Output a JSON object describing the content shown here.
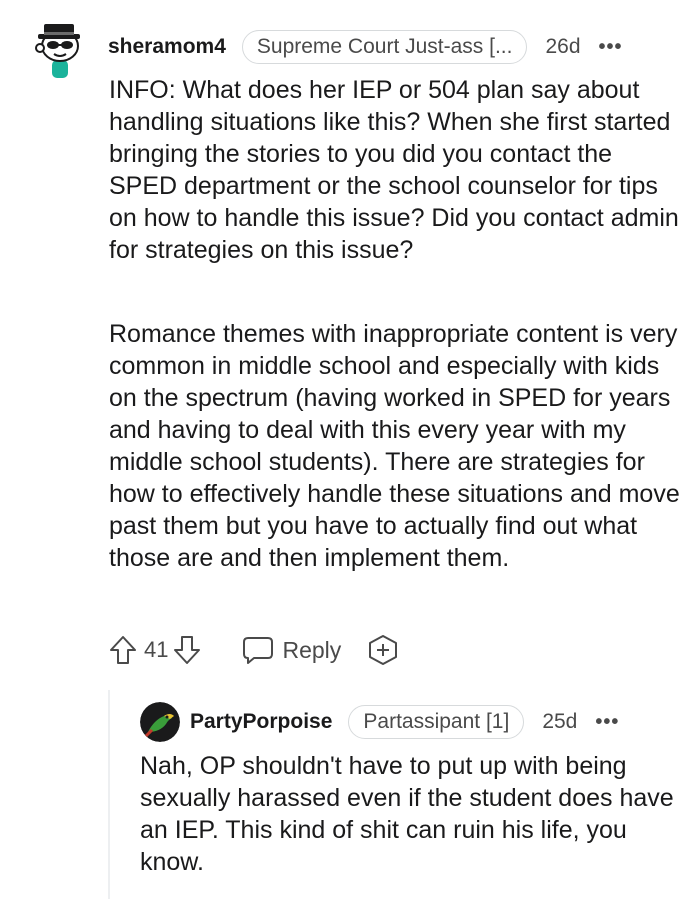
{
  "comment": {
    "username": "sheramom4",
    "flair": "Supreme Court Just-ass [...",
    "age": "26d",
    "more": "•••",
    "paragraphs": [
      "INFO: What does her IEP or 504 plan say about handling situations like this? When she first started bringing the stories to you did you contact the SPED department or the school counselor for tips on how to handle this issue? Did you contact admin for strategies on this issue?",
      "Romance themes with inappropriate content is very common in middle school and especially with kids on the spectrum (having worked in SPED for years and having to deal with this every year with my middle school students). There are strategies for how to effectively handle these situations and move past them but you have to actually find out what those are and then implement them."
    ],
    "votes": "41",
    "reply_label": "Reply"
  },
  "reply": {
    "username": "PartyPorpoise",
    "flair": "Partassipant [1]",
    "age": "25d",
    "more": "•••",
    "text": "Nah, OP shouldn't have to put up with being sexually harassed even if the student does have an IEP. This kind of shit can ruin his life, you know."
  },
  "icons": {
    "upvote": "arrow-up-icon",
    "downvote": "arrow-down-icon",
    "reply": "speech-bubble-icon",
    "award": "add-award-icon"
  },
  "colors": {
    "text": "#1a1a1b",
    "muted": "#4a4a4a",
    "border": "#d7dadc",
    "thread": "#edeff1"
  }
}
